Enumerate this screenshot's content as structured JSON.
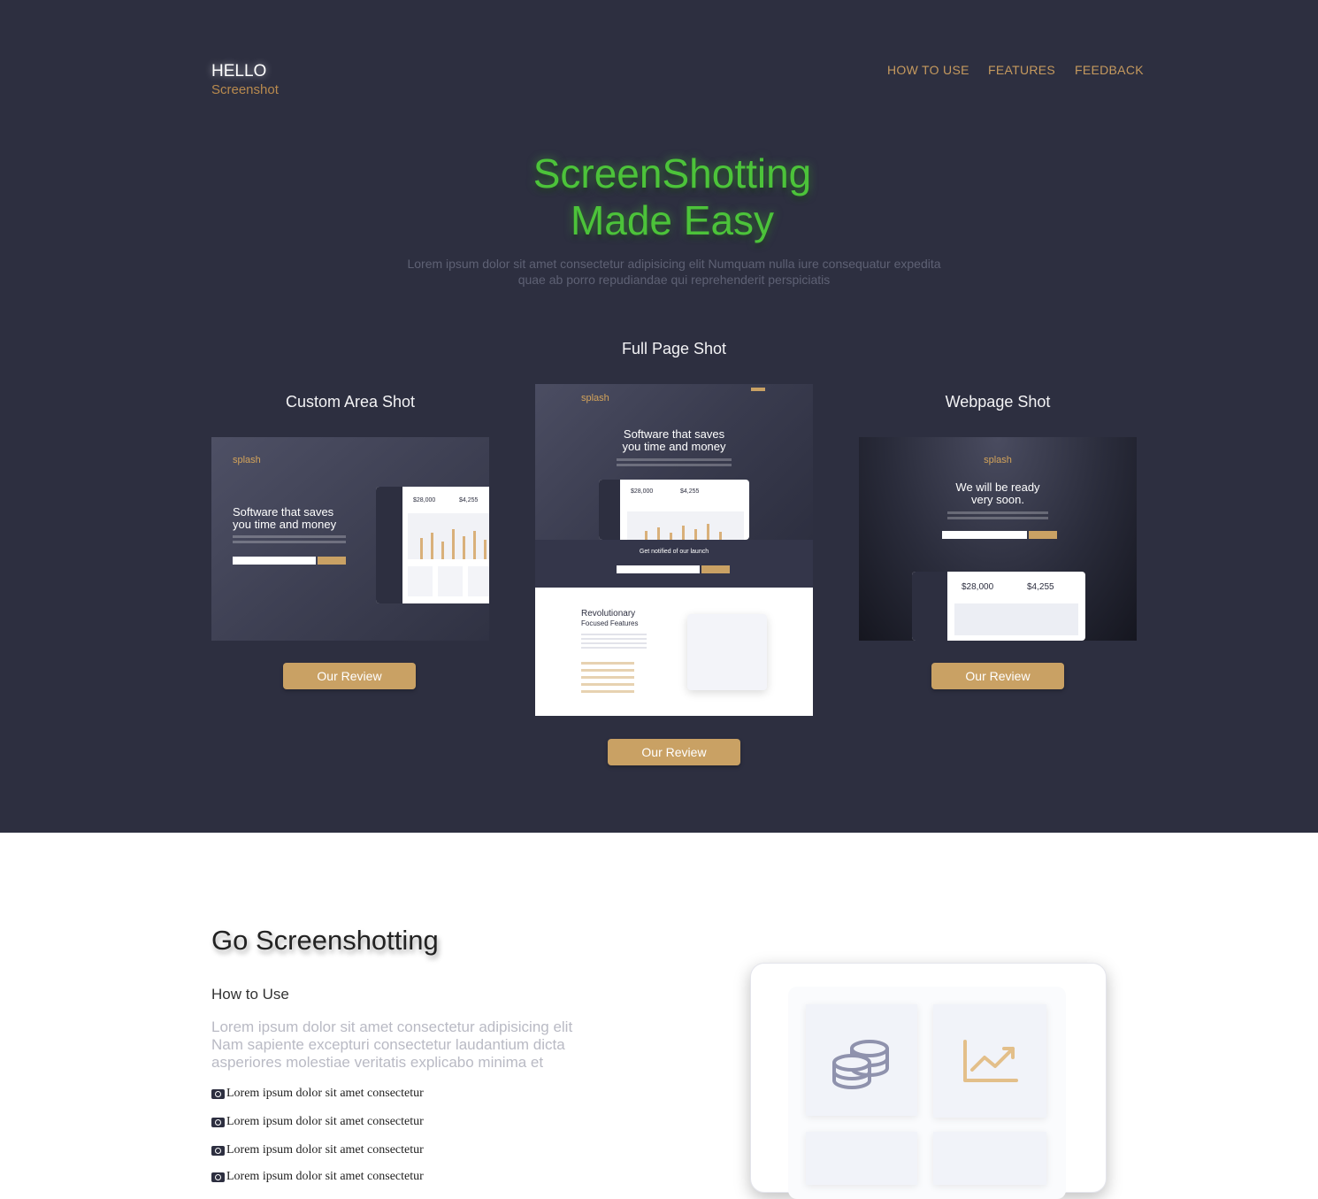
{
  "brand": {
    "hello": "HELLO",
    "sub": "Screenshot"
  },
  "nav": {
    "items": [
      "HOW TO USE",
      "FEATURES",
      "FEEDBACK"
    ]
  },
  "hero": {
    "title_line1": "ScreenShotting",
    "title_line2": "Made Easy",
    "desc_line1": "Lorem ipsum dolor sit amet consectetur adipisicing elit Numquam nulla iure consequatur expedita",
    "desc_line2": "quae ab porro repudiandae qui reprehenderit perspiciatis"
  },
  "shots": {
    "full": {
      "title": "Full Page Shot",
      "button": "Our Review"
    },
    "custom": {
      "title": "Custom Area Shot",
      "button": "Our Review"
    },
    "webpage": {
      "title": "Webpage Shot",
      "button": "Our Review"
    }
  },
  "mockups": {
    "brand": "splash",
    "custom_heading_1": "Software that saves",
    "custom_heading_2": "you time and money",
    "full_heading_1": "Software that saves",
    "full_heading_2": "you time and money",
    "full_notify": "Get notified of our launch",
    "full_features_1": "Revolutionary",
    "full_features_2": "Focused Features",
    "web_heading_1": "We will be ready",
    "web_heading_2": "very soon.",
    "stat_1": "$28,000",
    "stat_2": "$4,255"
  },
  "section2": {
    "title": "Go Screenshotting",
    "subtitle": "How to Use",
    "desc_line1": "Lorem ipsum dolor sit amet consectetur adipisicing elit",
    "desc_line2": "Nam sapiente excepturi consectetur laudantium dicta",
    "desc_line3": "asperiores molestiae veritatis explicabo minima et",
    "features": [
      "Lorem ipsum dolor sit amet consectetur",
      "Lorem ipsum dolor sit amet consectetur",
      "Lorem ipsum dolor sit amet consectetur",
      "Lorem ipsum dolor sit amet consectetur"
    ]
  },
  "icons": [
    "camera-icon",
    "coins-icon",
    "chart-up-icon"
  ],
  "colors": {
    "hero_bg": "#2d2f40",
    "accent": "#c9a164",
    "title_green": "#4cc33a"
  }
}
